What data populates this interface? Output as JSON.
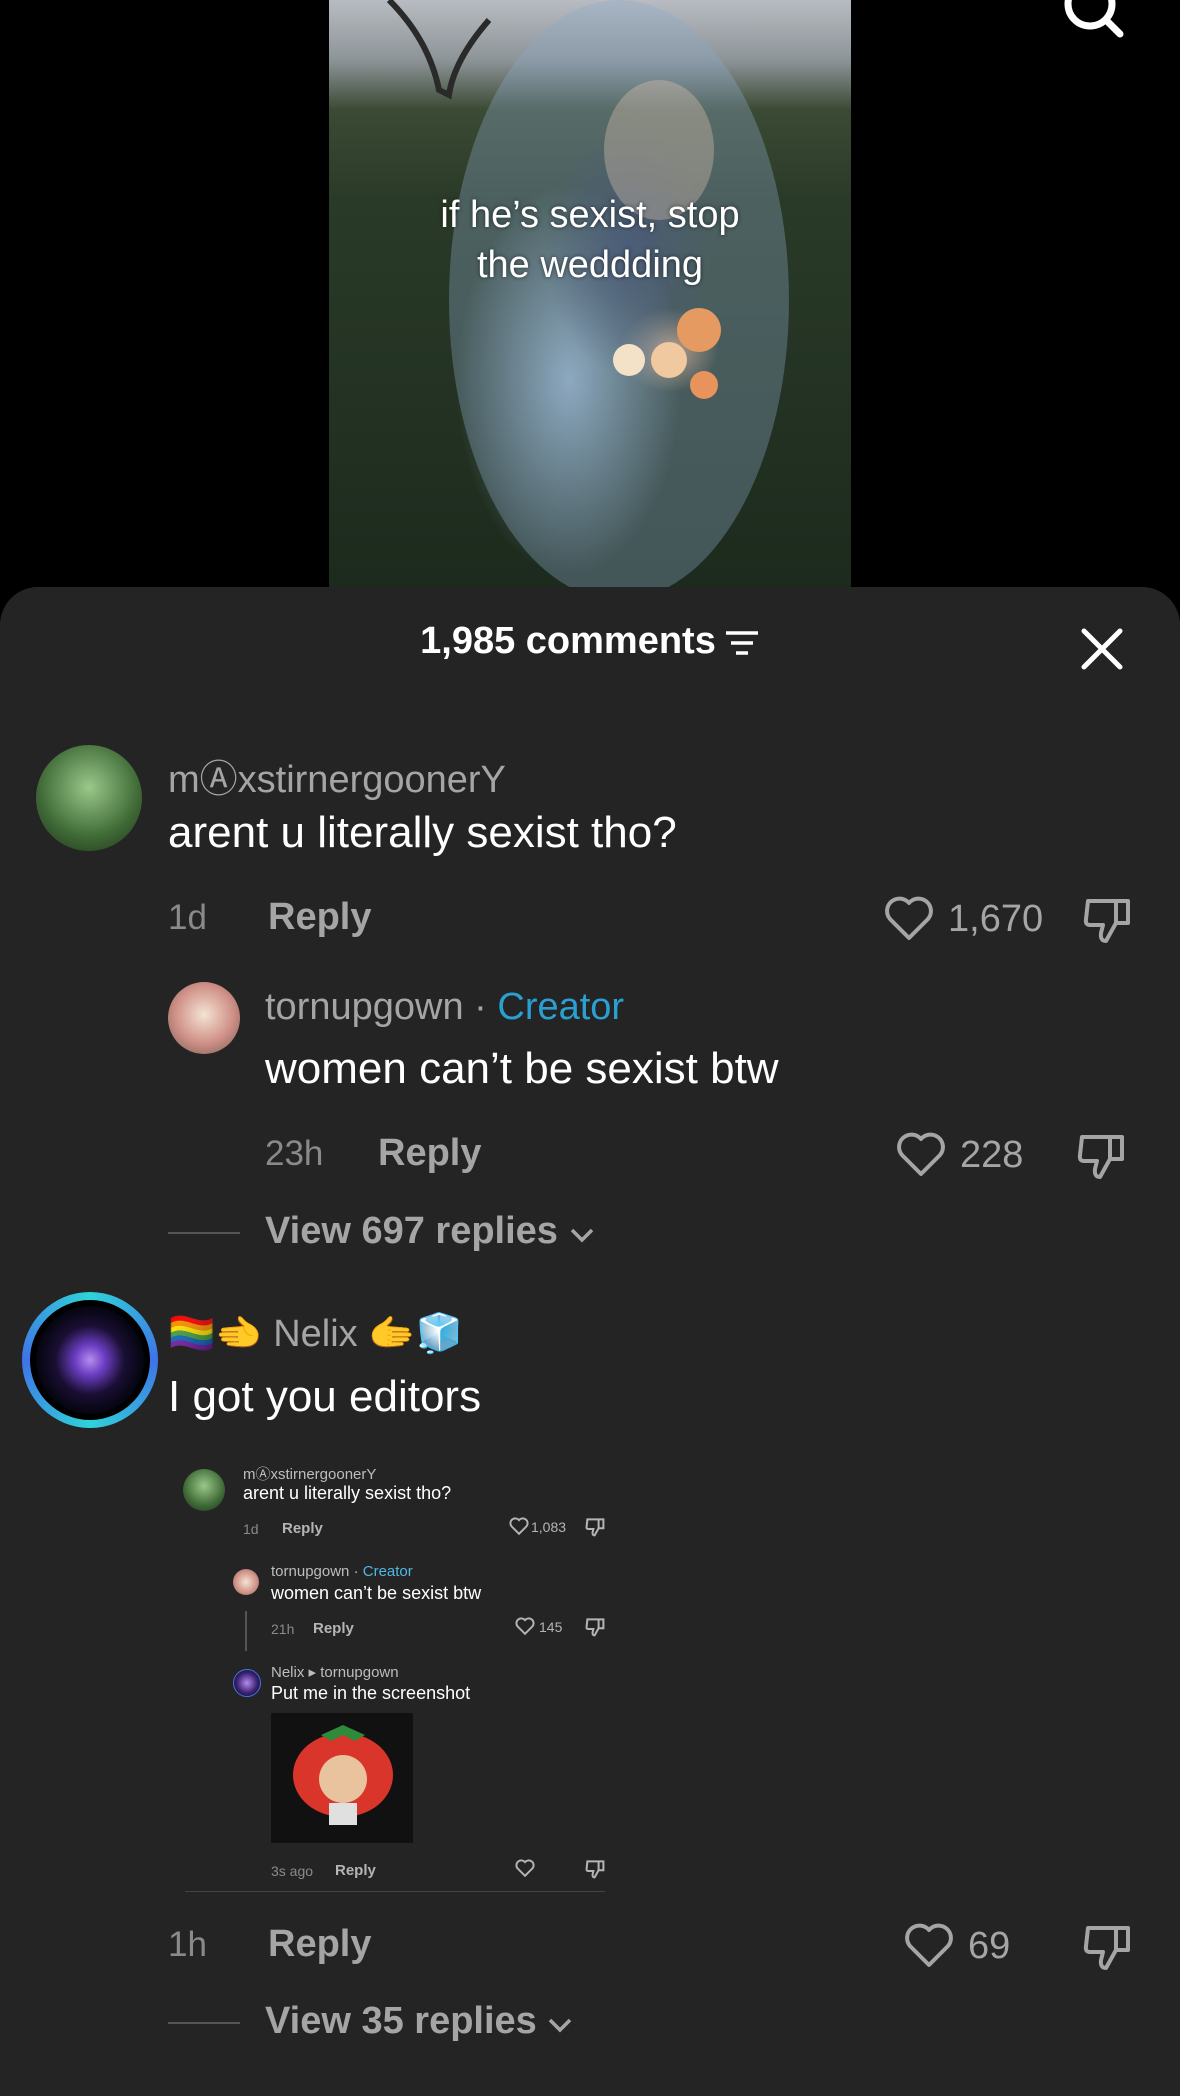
{
  "video": {
    "overlay_text": "if he’s sexist, stop the weddding"
  },
  "sheet": {
    "title": "1,985 comments"
  },
  "comments": [
    {
      "user": "mⒶxstirnergoonerY",
      "text": "arent u literally sexist tho?",
      "time": "1d",
      "reply_label": "Reply",
      "likes": "1,670"
    },
    {
      "user": "tornupgown",
      "separator": "·",
      "badge": "Creator",
      "text": "women can’t be sexist btw",
      "time": "23h",
      "reply_label": "Reply",
      "likes": "228"
    },
    {
      "view_replies": "View 697 replies"
    },
    {
      "user_prefix_emoji": "🏳️‍🌈🫲",
      "user": "Nelix",
      "user_suffix_emoji": "🫱🧊",
      "text": "I got you editors",
      "time": "1h",
      "reply_label": "Reply",
      "likes": "69"
    },
    {
      "view_replies": "View 35 replies"
    }
  ],
  "screenshot": {
    "c1": {
      "user": "mⒶxstirnergoonerY",
      "text": "arent u literally sexist tho?",
      "time": "1d",
      "reply": "Reply",
      "likes": "1,083"
    },
    "c2": {
      "user": "tornupgown",
      "badge": "Creator",
      "text": "women can’t be sexist btw",
      "time": "21h",
      "reply": "Reply",
      "likes": "145"
    },
    "c3": {
      "user": "Nelix",
      "reply_to": "tornupgown",
      "text": "Put me in the screenshot",
      "time": "3s ago",
      "reply": "Reply"
    }
  },
  "colors": {
    "creator": "#2aa0d2",
    "sheet_bg": "#242424"
  }
}
